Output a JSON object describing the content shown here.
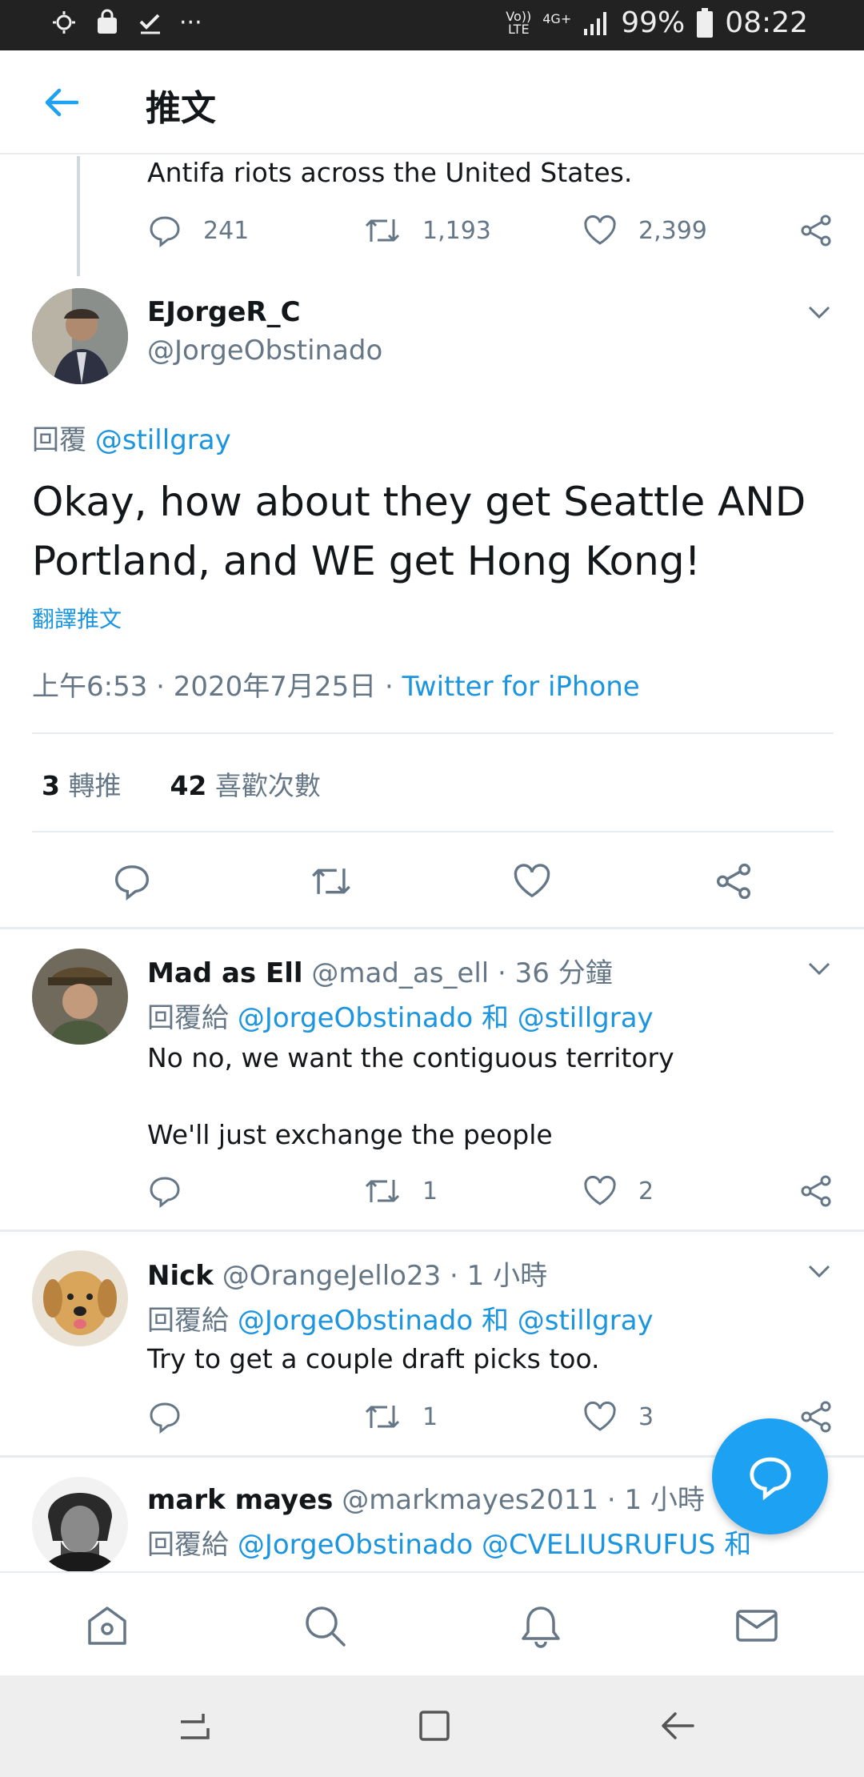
{
  "status_bar": {
    "left_dots": "···",
    "network_top": "Vo))",
    "network_bottom": "LTE",
    "signal_label": "4G+",
    "battery": "99%",
    "time": "08:22"
  },
  "header": {
    "title": "推文"
  },
  "prev_tweet": {
    "text": "Antifa riots across the United States.",
    "replies": "241",
    "retweets": "1,193",
    "likes": "2,399"
  },
  "main_tweet": {
    "display_name": "EJorgeR_C",
    "handle": "@JorgeObstinado",
    "reply_prefix": "回覆",
    "reply_to": "@stillgray",
    "text": "Okay, how about they get Seattle AND Portland, and WE get Hong Kong!",
    "translate": "翻譯推文",
    "meta": "上午6:53 · 2020年7月25日 ·",
    "source": "Twitter for iPhone",
    "retweet_count": "3",
    "retweet_label": "轉推",
    "like_count": "42",
    "like_label": "喜歡次數"
  },
  "replies": [
    {
      "display_name": "Mad as Ell",
      "handle": "@mad_as_ell",
      "time": "· 36 分鐘",
      "to_prefix": "回覆給",
      "to_1": "@JorgeObstinado",
      "and": "和",
      "to_2": "@stillgray",
      "line1": "No no, we want the contiguous territory",
      "line2": "We'll just exchange the people",
      "retweets": "1",
      "likes": "2"
    },
    {
      "display_name": "Nick",
      "handle": "@OrangeJello23",
      "time": "· 1 小時",
      "to_prefix": "回覆給",
      "to_1": "@JorgeObstinado",
      "and": "和",
      "to_2": "@stillgray",
      "line1": "Try to get a couple draft picks too.",
      "retweets": "1",
      "likes": "3"
    },
    {
      "display_name": "mark mayes",
      "handle": "@markmayes2011",
      "time": "· 1 小時",
      "to_prefix": "回覆給",
      "to_1": "@JorgeObstinado",
      "to_2": "@CVELIUSRUFUS",
      "and": "和"
    }
  ],
  "colors": {
    "accent": "#1da1f2",
    "link": "#1b95e0",
    "grey": "#657786"
  }
}
